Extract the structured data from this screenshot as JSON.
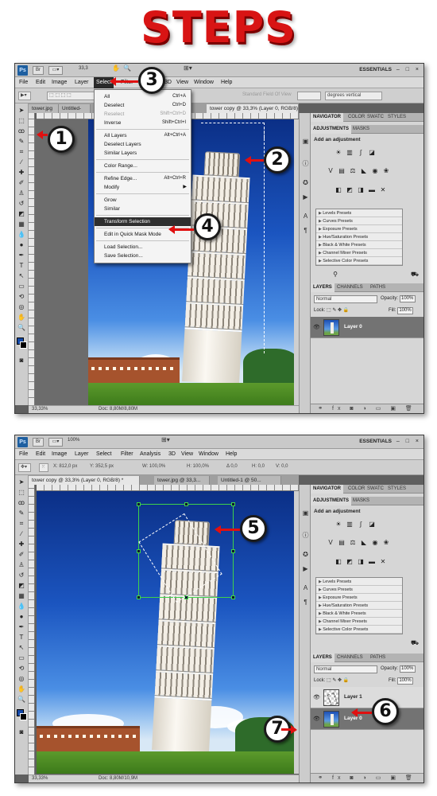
{
  "headline": "STEPS",
  "colors": {
    "headline_red": "#d81414",
    "callout_arrow": "#e01010",
    "highlight_dark": "#2f2f2f",
    "photoshop_blue": "#1e5fa0"
  },
  "app": {
    "logo": "Ps",
    "zoom_value": "33,3",
    "zoom_value_2": "100%",
    "workspace": "ESSENTIALS",
    "window_controls": "– □ ×"
  },
  "menu": [
    "File",
    "Edit",
    "Image",
    "Layer",
    "Select",
    "Filter",
    "3D",
    "View",
    "Window",
    "Help"
  ],
  "menu2": [
    "File",
    "Edit",
    "Image",
    "Layer",
    "Select",
    "Filter",
    "Analysis",
    "3D",
    "View",
    "Window",
    "Help"
  ],
  "options1": {
    "field_of_view": "Standard Field Of View",
    "degrees": "degrees vertical"
  },
  "options2": {
    "x_label": "X:",
    "x_value": "812,0 px",
    "y_label": "Y:",
    "y_value": "352,5 px",
    "w_label": "W:",
    "w_value": "100,0%",
    "h_label": "H:",
    "h_value": "100,0%",
    "a_label": "Δ",
    "a_value": "0,0",
    "hv_label": "H:",
    "hv_value": "0,0",
    "v_label": "V:",
    "v_value": "0,0"
  },
  "tabs1": [
    "tower.jpg",
    "Untitled-",
    "tower copy @ 33,3% (Layer 0, RGB/8) *"
  ],
  "tabs2": [
    "tower copy @ 33,3% (Layer 0, RGB/8) *",
    "tower.jpg @ 33,3...",
    "Untitled-1 @ 50..."
  ],
  "dropdown": [
    {
      "label": "All",
      "shortcut": "Ctrl+A",
      "disabled": false
    },
    {
      "label": "Deselect",
      "shortcut": "Ctrl+D",
      "disabled": false
    },
    {
      "label": "Reselect",
      "shortcut": "Shift+Ctrl+D",
      "disabled": true
    },
    {
      "label": "Inverse",
      "shortcut": "Shift+Ctrl+I",
      "disabled": false
    },
    {
      "sep": true
    },
    {
      "label": "All Layers",
      "shortcut": "Alt+Ctrl+A",
      "disabled": false
    },
    {
      "label": "Deselect Layers",
      "shortcut": "",
      "disabled": false
    },
    {
      "label": "Similar Layers",
      "shortcut": "",
      "disabled": false
    },
    {
      "sep": true
    },
    {
      "label": "Color Range...",
      "shortcut": "",
      "disabled": false
    },
    {
      "sep": true
    },
    {
      "label": "Refine Edge...",
      "shortcut": "Alt+Ctrl+R",
      "disabled": false
    },
    {
      "label": "Modify",
      "shortcut": "",
      "submenu": true,
      "disabled": false
    },
    {
      "sep": true
    },
    {
      "label": "Grow",
      "shortcut": "",
      "disabled": false
    },
    {
      "label": "Similar",
      "shortcut": "",
      "disabled": false
    },
    {
      "sep": true
    },
    {
      "label": "Transform Selection",
      "shortcut": "",
      "disabled": false,
      "highlight": true
    },
    {
      "sep": true
    },
    {
      "label": "Edit in Quick Mask Mode",
      "shortcut": "",
      "disabled": false
    },
    {
      "sep": true
    },
    {
      "label": "Load Selection...",
      "shortcut": "",
      "disabled": false
    },
    {
      "label": "Save Selection...",
      "shortcut": "",
      "disabled": false
    }
  ],
  "panel_tabs_top": [
    "NAVIGATOR",
    "COLOR",
    "SWATC",
    "STYLES"
  ],
  "panel_tabs_adj": [
    "ADJUSTMENTS",
    "MASKS"
  ],
  "adjust_title": "Add an adjustment",
  "presets": [
    "Levels Presets",
    "Curves Presets",
    "Exposure Presets",
    "Hue/Saturation Presets",
    "Black & White Presets",
    "Channel Mixer Presets",
    "Selective Color Presets"
  ],
  "layers_tabs": [
    "LAYERS",
    "CHANNELS",
    "PATHS"
  ],
  "blend_mode": "Normal",
  "opacity_label": "Opacity:",
  "opacity_value": "100%",
  "lock_label": "Lock:",
  "fill_label": "Fill:",
  "fill_value": "100%",
  "layers1": [
    {
      "name": "Layer 0",
      "type": "photo",
      "selected": true
    }
  ],
  "layers2": [
    {
      "name": "Layer 1",
      "type": "trans",
      "selected": false
    },
    {
      "name": "Layer 0",
      "type": "photo",
      "selected": true
    }
  ],
  "status": {
    "zoom": "33,33%",
    "doc1": "Doc: 8,80M/8,80M",
    "doc2": "Doc: 8,80M/10,9M"
  },
  "callouts": [
    "1",
    "2",
    "3",
    "4",
    "5",
    "6",
    "7"
  ],
  "icons": {
    "move": "move-tool-icon",
    "marquee": "rect-marquee-icon",
    "eye": "eye-icon",
    "hand": "hand-icon",
    "zoom": "zoom-icon"
  }
}
